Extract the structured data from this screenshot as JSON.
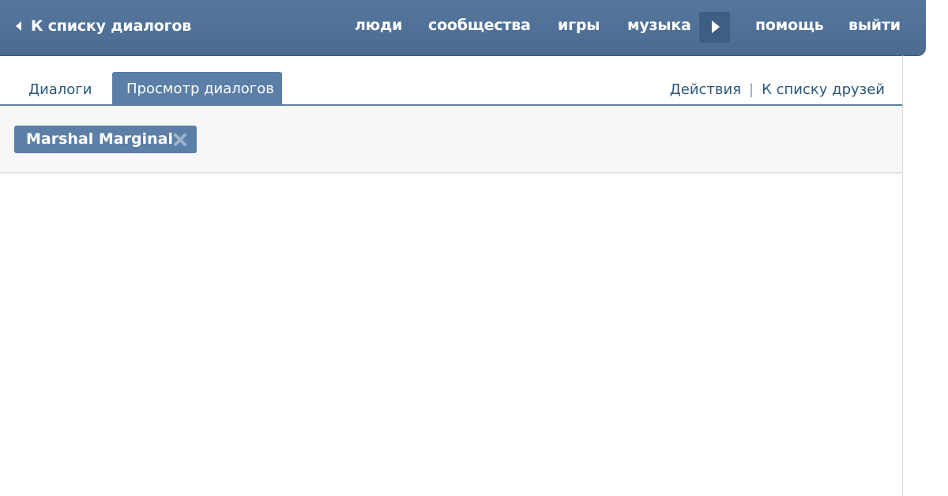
{
  "header": {
    "back_label": "К списку диалогов",
    "nav": {
      "people": "люди",
      "communities": "сообщества",
      "games": "игры",
      "music": "музыка",
      "help": "помощь",
      "logout": "выйти"
    },
    "more_icon": "triangle-right-icon",
    "back_icon": "triangle-left-icon"
  },
  "tabs": {
    "dialogs": "Диалоги",
    "view_dialogs": "Просмотр диалогов"
  },
  "actions": {
    "actions_label": "Действия",
    "separator": "|",
    "friends_list_label": "К списку друзей"
  },
  "filter": {
    "token_name": "Marshal Marginal",
    "remove_icon": "close-x-icon"
  },
  "colors": {
    "header_bg": "#4b6b92",
    "accent": "#5b7fa6",
    "link": "#2b587a",
    "panel_bg": "#f7f7f7"
  }
}
